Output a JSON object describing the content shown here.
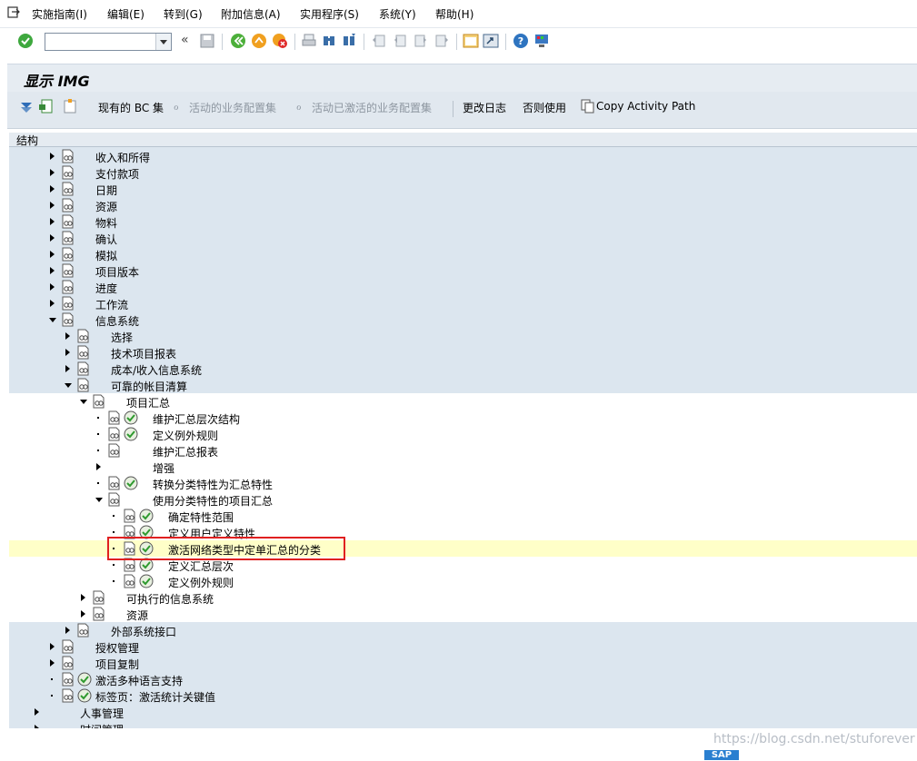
{
  "menubar": {
    "items": [
      {
        "label": "实施指南(I)"
      },
      {
        "label": "编辑(E)"
      },
      {
        "label": "转到(G)"
      },
      {
        "label": "附加信息(A)"
      },
      {
        "label": "实用程序(S)"
      },
      {
        "label": "系统(Y)"
      },
      {
        "label": "帮助(H)"
      }
    ]
  },
  "toolbar": {
    "command_field_value": "",
    "icons": [
      "enter-icon",
      "back-icon",
      "save-icon",
      "back-green-icon",
      "exit-yellow-icon",
      "cancel-red-icon",
      "print-icon",
      "find-icon",
      "find-next-icon",
      "first-page-icon",
      "previous-page-icon",
      "next-page-icon",
      "last-page-icon",
      "new-session-icon",
      "shortcut-icon",
      "help-icon",
      "layout-icon"
    ]
  },
  "title": "显示 IMG",
  "app_toolbar": {
    "existing_bc_sets": "现有的 BC 集",
    "active_bc_sets": "活动的业务配置集",
    "activated_bc_sets": "活动已激活的业务配置集",
    "change_log": "更改日志",
    "else_use": "否则使用",
    "copy_activity_path": "Copy Activity Path"
  },
  "tree": {
    "header": "结构",
    "rows": [
      {
        "label": "收入和所得",
        "level": 0,
        "expander": "collapsed",
        "exec": false,
        "bg": "blue"
      },
      {
        "label": "支付款项",
        "level": 0,
        "expander": "collapsed",
        "exec": false,
        "bg": "blue"
      },
      {
        "label": "日期",
        "level": 0,
        "expander": "collapsed",
        "exec": false,
        "bg": "blue"
      },
      {
        "label": "资源",
        "level": 0,
        "expander": "collapsed",
        "exec": false,
        "bg": "blue"
      },
      {
        "label": "物料",
        "level": 0,
        "expander": "collapsed",
        "exec": false,
        "bg": "blue"
      },
      {
        "label": "确认",
        "level": 0,
        "expander": "collapsed",
        "exec": false,
        "bg": "blue"
      },
      {
        "label": "模拟",
        "level": 0,
        "expander": "collapsed",
        "exec": false,
        "bg": "blue"
      },
      {
        "label": "项目版本",
        "level": 0,
        "expander": "collapsed",
        "exec": false,
        "bg": "blue"
      },
      {
        "label": "进度",
        "level": 0,
        "expander": "collapsed",
        "exec": false,
        "bg": "blue"
      },
      {
        "label": "工作流",
        "level": 0,
        "expander": "collapsed",
        "exec": false,
        "bg": "blue"
      },
      {
        "label": "信息系统",
        "level": 0,
        "expander": "expanded",
        "exec": false,
        "bg": "blue"
      },
      {
        "label": "选择",
        "level": 1,
        "expander": "collapsed",
        "exec": false,
        "bg": "blue"
      },
      {
        "label": "技术项目报表",
        "level": 1,
        "expander": "collapsed",
        "exec": false,
        "bg": "blue"
      },
      {
        "label": "成本/收入信息系统",
        "level": 1,
        "expander": "collapsed",
        "exec": false,
        "bg": "blue"
      },
      {
        "label": "可靠的帐目清算",
        "level": 1,
        "expander": "expanded",
        "exec": false,
        "bg": "blue"
      },
      {
        "label": "项目汇总",
        "level": 2,
        "expander": "expanded",
        "exec": false,
        "bg": "white"
      },
      {
        "label": "维护汇总层次结构",
        "level": 3,
        "expander": "leaf",
        "exec": true,
        "bg": "white"
      },
      {
        "label": "定义例外规则",
        "level": 3,
        "expander": "leaf",
        "exec": true,
        "bg": "white"
      },
      {
        "label": "维护汇总报表",
        "level": 3,
        "expander": "leaf",
        "exec": false,
        "bg": "white"
      },
      {
        "label": "增强",
        "level": 3,
        "expander": "collapsed",
        "exec": false,
        "noicon": true,
        "bg": "white"
      },
      {
        "label": "转换分类特性为汇总特性",
        "level": 3,
        "expander": "leaf",
        "exec": true,
        "bg": "white"
      },
      {
        "label": "使用分类特性的项目汇总",
        "level": 3,
        "expander": "expanded",
        "exec": false,
        "bg": "white"
      },
      {
        "label": "确定特性范围",
        "level": 4,
        "expander": "leaf",
        "exec": true,
        "bg": "white"
      },
      {
        "label": "定义用户定义特性",
        "level": 4,
        "expander": "leaf",
        "exec": true,
        "bg": "white"
      },
      {
        "label": "激活网络类型中定单汇总的分类",
        "level": 4,
        "expander": "leaf",
        "exec": true,
        "bg": "highlight"
      },
      {
        "label": "定义汇总层次",
        "level": 4,
        "expander": "leaf",
        "exec": true,
        "bg": "white"
      },
      {
        "label": "定义例外规则",
        "level": 4,
        "expander": "leaf",
        "exec": true,
        "bg": "white"
      },
      {
        "label": "可执行的信息系统",
        "level": 2,
        "expander": "collapsed",
        "exec": false,
        "bg": "white"
      },
      {
        "label": "资源",
        "level": 2,
        "expander": "collapsed",
        "exec": false,
        "bg": "white"
      },
      {
        "label": "外部系统接口",
        "level": 1,
        "expander": "collapsed",
        "exec": false,
        "bg": "blue"
      },
      {
        "label": "授权管理",
        "level": 0,
        "expander": "collapsed",
        "exec": false,
        "bg": "blue"
      },
      {
        "label": "项目复制",
        "level": 0,
        "expander": "collapsed",
        "exec": false,
        "bg": "blue"
      },
      {
        "label": "激活多种语言支持",
        "level": 0,
        "expander": "leaf",
        "exec": true,
        "bg": "blue"
      },
      {
        "label": "标签页：激活统计关键值",
        "level": 0,
        "expander": "leaf",
        "exec": true,
        "bg": "blue"
      },
      {
        "label": "人事管理",
        "level": -1,
        "expander": "collapsed",
        "exec": false,
        "noicon": true,
        "bg": "blue"
      },
      {
        "label": "时间管理",
        "level": -1,
        "expander": "collapsed",
        "exec": false,
        "noicon": true,
        "bg": "blue"
      }
    ]
  },
  "watermark": "https://blog.csdn.net/stuforever",
  "sap_logo": "SAP"
}
